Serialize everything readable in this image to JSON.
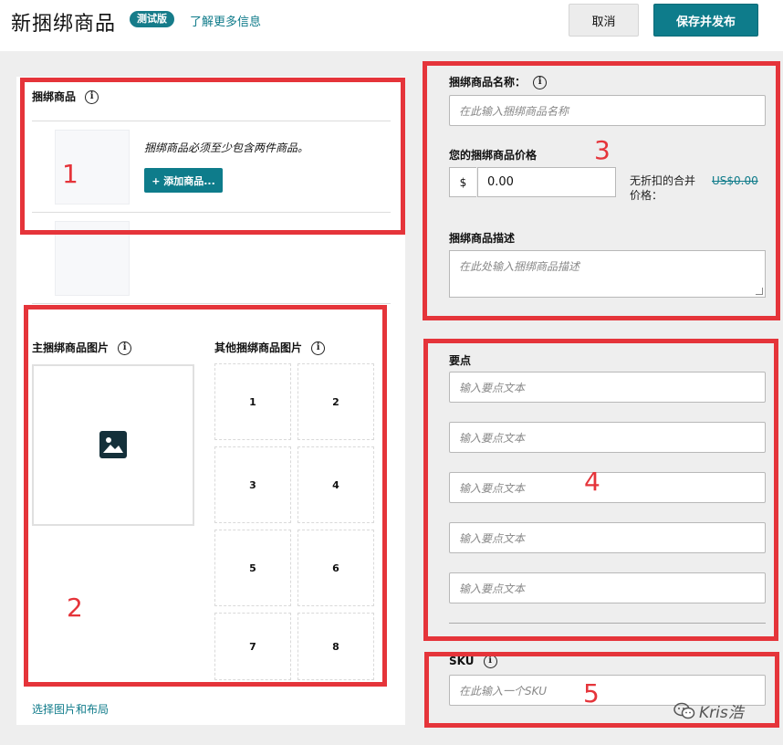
{
  "header": {
    "title": "新捆绑商品",
    "badge": "测试版",
    "learn_more": "了解更多信息",
    "cancel": "取消",
    "publish": "保存并发布"
  },
  "bundle_products": {
    "label": "捆绑商品",
    "hint": "捆绑商品必须至少包含两件商品。",
    "add_button": "+ 添加商品..."
  },
  "images": {
    "main_label": "主捆绑商品图片",
    "other_label": "其他捆绑商品图片",
    "slots": [
      "1",
      "2",
      "3",
      "4",
      "5",
      "6",
      "7",
      "8"
    ],
    "choose_layout": "选择图片和布局"
  },
  "details": {
    "name_label": "捆绑商品名称：",
    "name_placeholder": "在此输入捆绑商品名称",
    "price_label": "您的捆绑商品价格",
    "currency": "$",
    "price_value": "0.00",
    "combined_label": "无折扣的合并价格：",
    "combined_value": "US$0.00",
    "desc_label": "捆绑商品描述",
    "desc_placeholder": "在此处输入捆绑商品描述"
  },
  "bullets": {
    "label": "要点",
    "placeholder": "输入要点文本",
    "count": 5
  },
  "sku": {
    "label": "SKU",
    "placeholder": "在此输入一个SKU"
  },
  "annotations": {
    "n1": "1",
    "n2": "2",
    "n3": "3",
    "n4": "4",
    "n5": "5"
  },
  "watermark": "Kris浩",
  "colors": {
    "accent": "#0e7c8b",
    "highlight": "#e5343a",
    "panel": "#eeeeee"
  }
}
